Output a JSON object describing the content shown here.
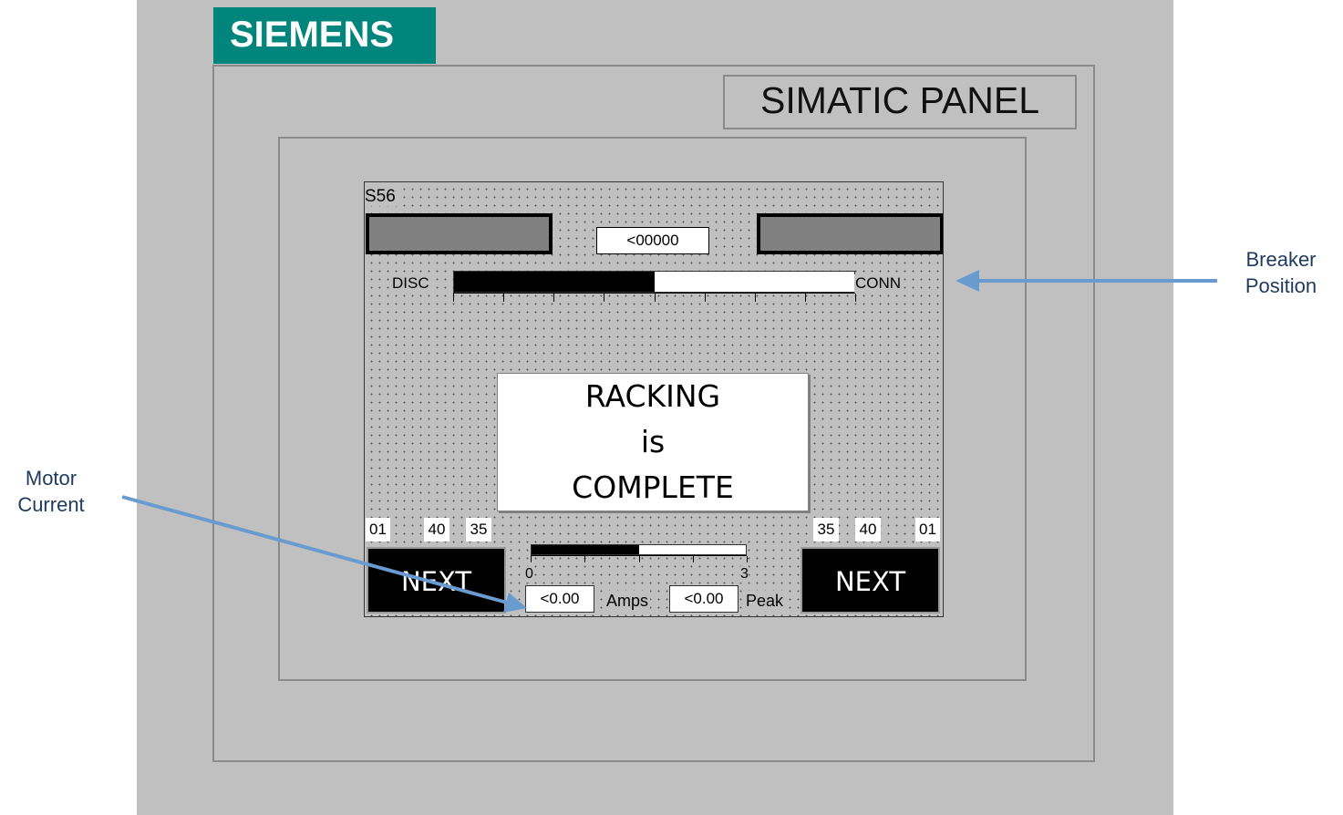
{
  "brand": {
    "logo_text": "SIEMENS",
    "color": "#00857c"
  },
  "panel": {
    "label": "SIMATIC PANEL"
  },
  "screen": {
    "id": "S56",
    "counter": "<00000",
    "status_indicators": {
      "left_color": "#808080",
      "right_color": "#808080"
    },
    "breaker_position": {
      "left_label": "DISC",
      "right_label": "CONN",
      "fill_fraction": 0.5,
      "tick_count": 9
    },
    "message": {
      "line1": "RACKING",
      "line2": "is",
      "line3": "COMPLETE"
    },
    "left_values": [
      "01",
      "40",
      "35"
    ],
    "right_values": [
      "35",
      "40",
      "01"
    ],
    "next_left_label": "NEXT",
    "next_right_label": "NEXT",
    "motor_current": {
      "scale_min": "0",
      "scale_max": "3",
      "fill_fraction": 0.5,
      "tick_count": 5,
      "value": "<0.00",
      "value_unit": "Amps",
      "peak": "<0.00",
      "peak_unit": "Peak"
    }
  },
  "callouts": {
    "breaker_line1": "Breaker",
    "breaker_line2": "Position",
    "motor_line1": "Motor",
    "motor_line2": "Current",
    "arrow_color": "#6a9bd0"
  }
}
